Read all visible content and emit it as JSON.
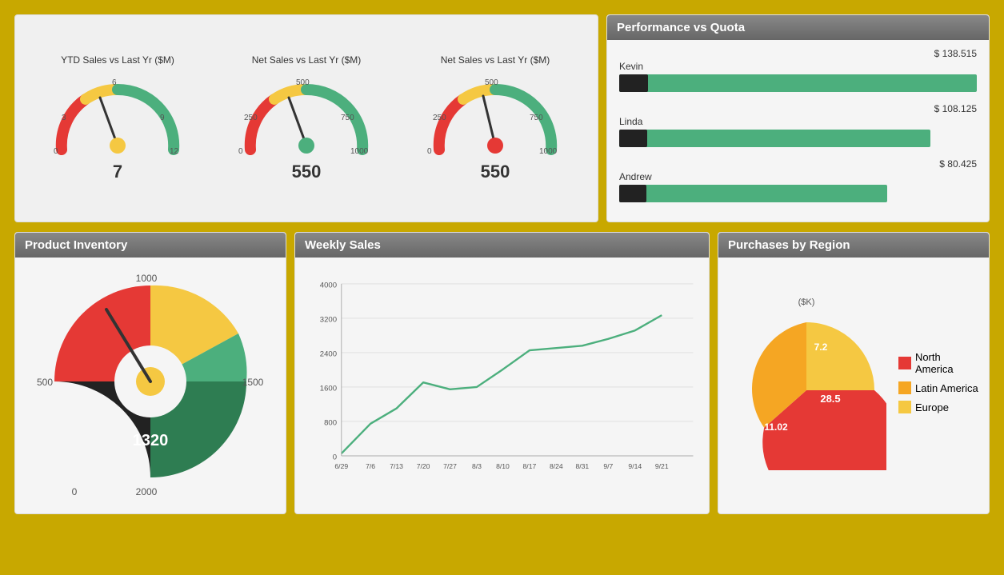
{
  "colors": {
    "accent": "#c8a800",
    "header_bg": "#777",
    "green": "#4caf7d",
    "red": "#e53935",
    "orange": "#f5a623",
    "yellow": "#f5c842",
    "black": "#222",
    "dark_green": "#2e7d52"
  },
  "gauges": {
    "gauge1": {
      "title": "YTD Sales vs Last Yr ($M)",
      "value": "7",
      "min": "0",
      "max": "12",
      "mid_left": "3",
      "mid_right": "9",
      "top": "6",
      "needle_angle": -15,
      "indicator_color": "#f5c842"
    },
    "gauge2": {
      "title": "Net Sales vs Last Yr ($M)",
      "value": "550",
      "min": "0",
      "max": "1000",
      "mid_left": "250",
      "mid_right": "750",
      "top": "500",
      "needle_angle": -10,
      "indicator_color": "#4caf7d"
    },
    "gauge3": {
      "title": "Net Sales vs Last Yr ($M)",
      "value": "550",
      "min": "0",
      "max": "1000",
      "mid_left": "250",
      "mid_right": "750",
      "top": "500",
      "needle_angle": -10,
      "indicator_color": "#e53935"
    }
  },
  "performance": {
    "title": "Performance vs Quota",
    "rows": [
      {
        "name": "Kevin",
        "amount": "$ 138.515",
        "bar_pct": 92,
        "black_pct": 8
      },
      {
        "name": "Linda",
        "amount": "$ 108.125",
        "bar_pct": 85,
        "black_pct": 8
      },
      {
        "name": "Andrew",
        "amount": "$ 80.425",
        "bar_pct": 78,
        "black_pct": 8
      }
    ]
  },
  "inventory": {
    "title": "Product Inventory",
    "value": "1320",
    "labels": [
      "0",
      "500",
      "1000",
      "1500",
      "2000"
    ]
  },
  "weekly_sales": {
    "title": "Weekly Sales",
    "y_labels": [
      "0",
      "800",
      "1600",
      "2400",
      "3200",
      "4000"
    ],
    "x_labels": [
      "6/29",
      "7/6",
      "7/13",
      "7/20",
      "7/27",
      "8/3",
      "8/10",
      "8/17",
      "8/24",
      "8/31",
      "9/7",
      "9/14",
      "9/21"
    ],
    "data": [
      50,
      750,
      1100,
      1700,
      1550,
      1600,
      2000,
      2450,
      2500,
      2550,
      2700,
      2900,
      3250
    ]
  },
  "purchases": {
    "title": "Purchases by Region",
    "subtitle": "($K)",
    "segments": [
      {
        "label": "North America",
        "value": "28.5",
        "color": "#e53935",
        "start_angle": 0,
        "sweep": 195
      },
      {
        "label": "Latin America",
        "value": "11.02",
        "color": "#f5a623",
        "start_angle": 195,
        "sweep": 75
      },
      {
        "label": "Europe",
        "value": "7.2",
        "color": "#f5c842",
        "start_angle": 270,
        "sweep": 90
      }
    ]
  }
}
